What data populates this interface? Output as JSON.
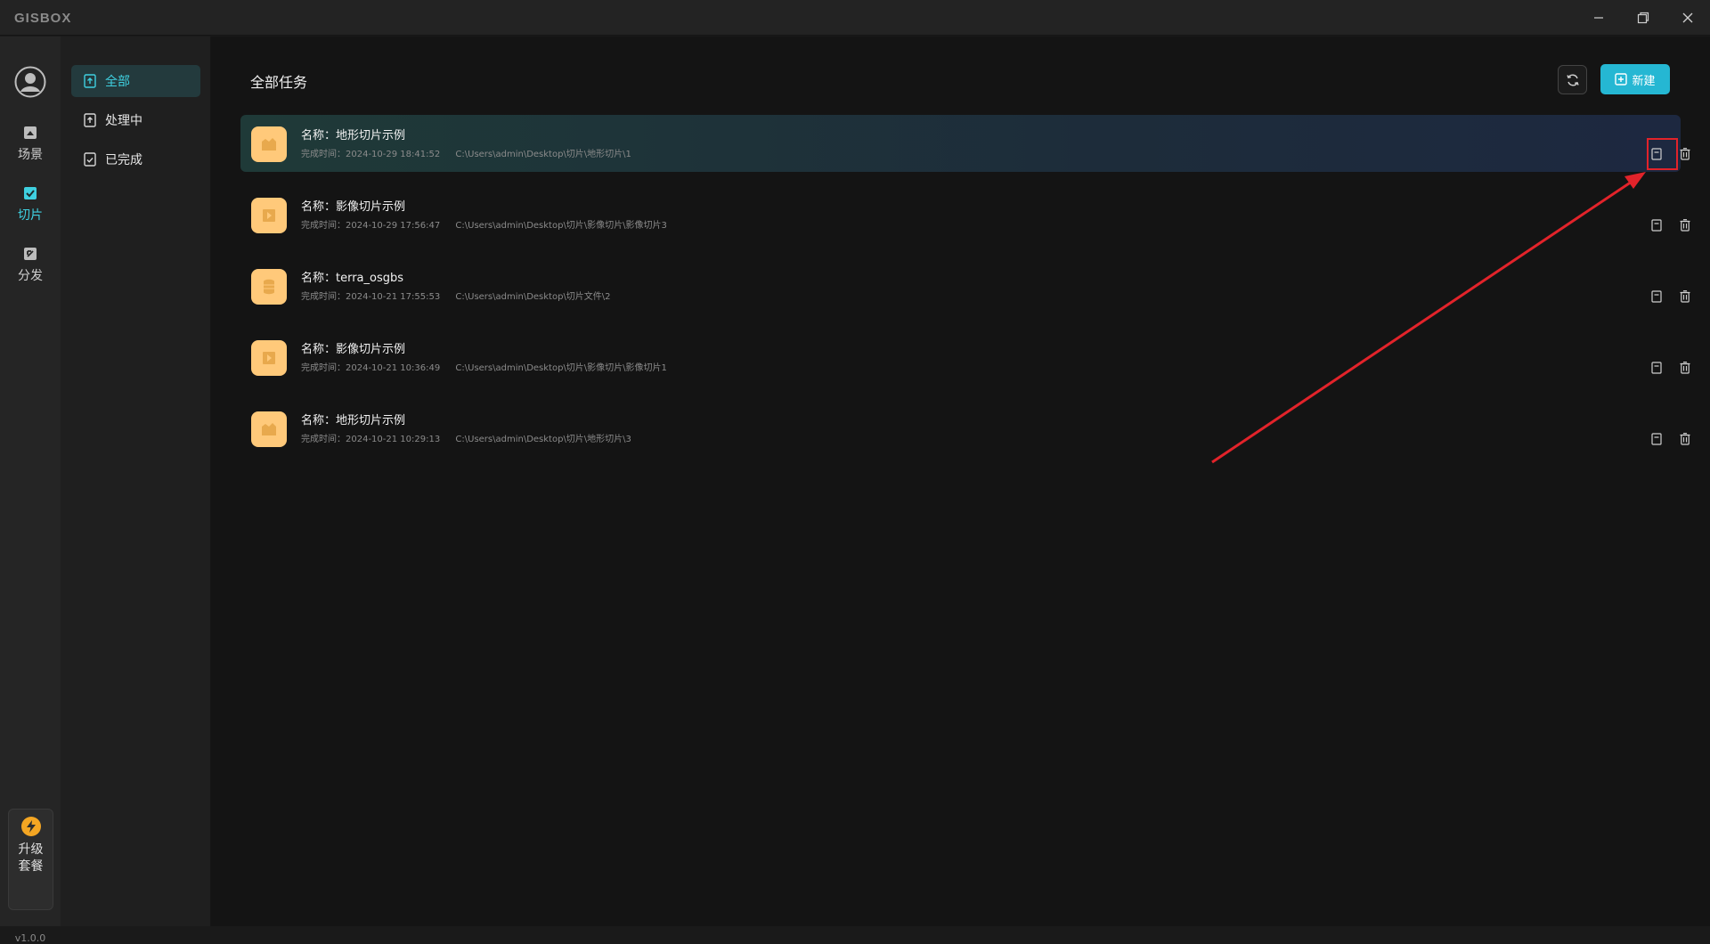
{
  "app": {
    "logo": "GISBOX"
  },
  "rail": {
    "items": [
      {
        "label": "场景",
        "icon": "scene-icon"
      },
      {
        "label": "切片",
        "icon": "slice-icon",
        "active": true
      },
      {
        "label": "分发",
        "icon": "distribute-icon"
      }
    ],
    "upgrade_line1": "升级",
    "upgrade_line2": "套餐",
    "version": "v1.0.0"
  },
  "subnav": {
    "items": [
      {
        "label": "全部",
        "active": true
      },
      {
        "label": "处理中"
      },
      {
        "label": "已完成"
      }
    ]
  },
  "main": {
    "title": "全部任务",
    "new_label": "新建",
    "tasks": [
      {
        "name": "名称：地形切片示例",
        "time": "完成时间：2024-10-29 18:41:52",
        "path": "C:\\Users\\admin\\Desktop\\切片\\地形切片\\1",
        "thumb": "terrain-icon"
      },
      {
        "name": "名称：影像切片示例",
        "time": "完成时间：2024-10-29 17:56:47",
        "path": "C:\\Users\\admin\\Desktop\\切片\\影像切片\\影像切片3",
        "thumb": "image-icon"
      },
      {
        "name": "名称：terra_osgbs",
        "time": "完成时间：2024-10-21 17:55:53",
        "path": "C:\\Users\\admin\\Desktop\\切片文件\\2",
        "thumb": "model-icon"
      },
      {
        "name": "名称：影像切片示例",
        "time": "完成时间：2024-10-21 10:36:49",
        "path": "C:\\Users\\admin\\Desktop\\切片\\影像切片\\影像切片1",
        "thumb": "image-icon"
      },
      {
        "name": "名称：地形切片示例",
        "time": "完成时间：2024-10-21 10:29:13",
        "path": "C:\\Users\\admin\\Desktop\\切片\\地形切片\\3",
        "thumb": "terrain-icon"
      }
    ]
  },
  "colors": {
    "accent": "#25b7d3",
    "accent_text": "#3fd0e0",
    "highlight": "#e2232a",
    "thumb": "#ffc97a"
  }
}
